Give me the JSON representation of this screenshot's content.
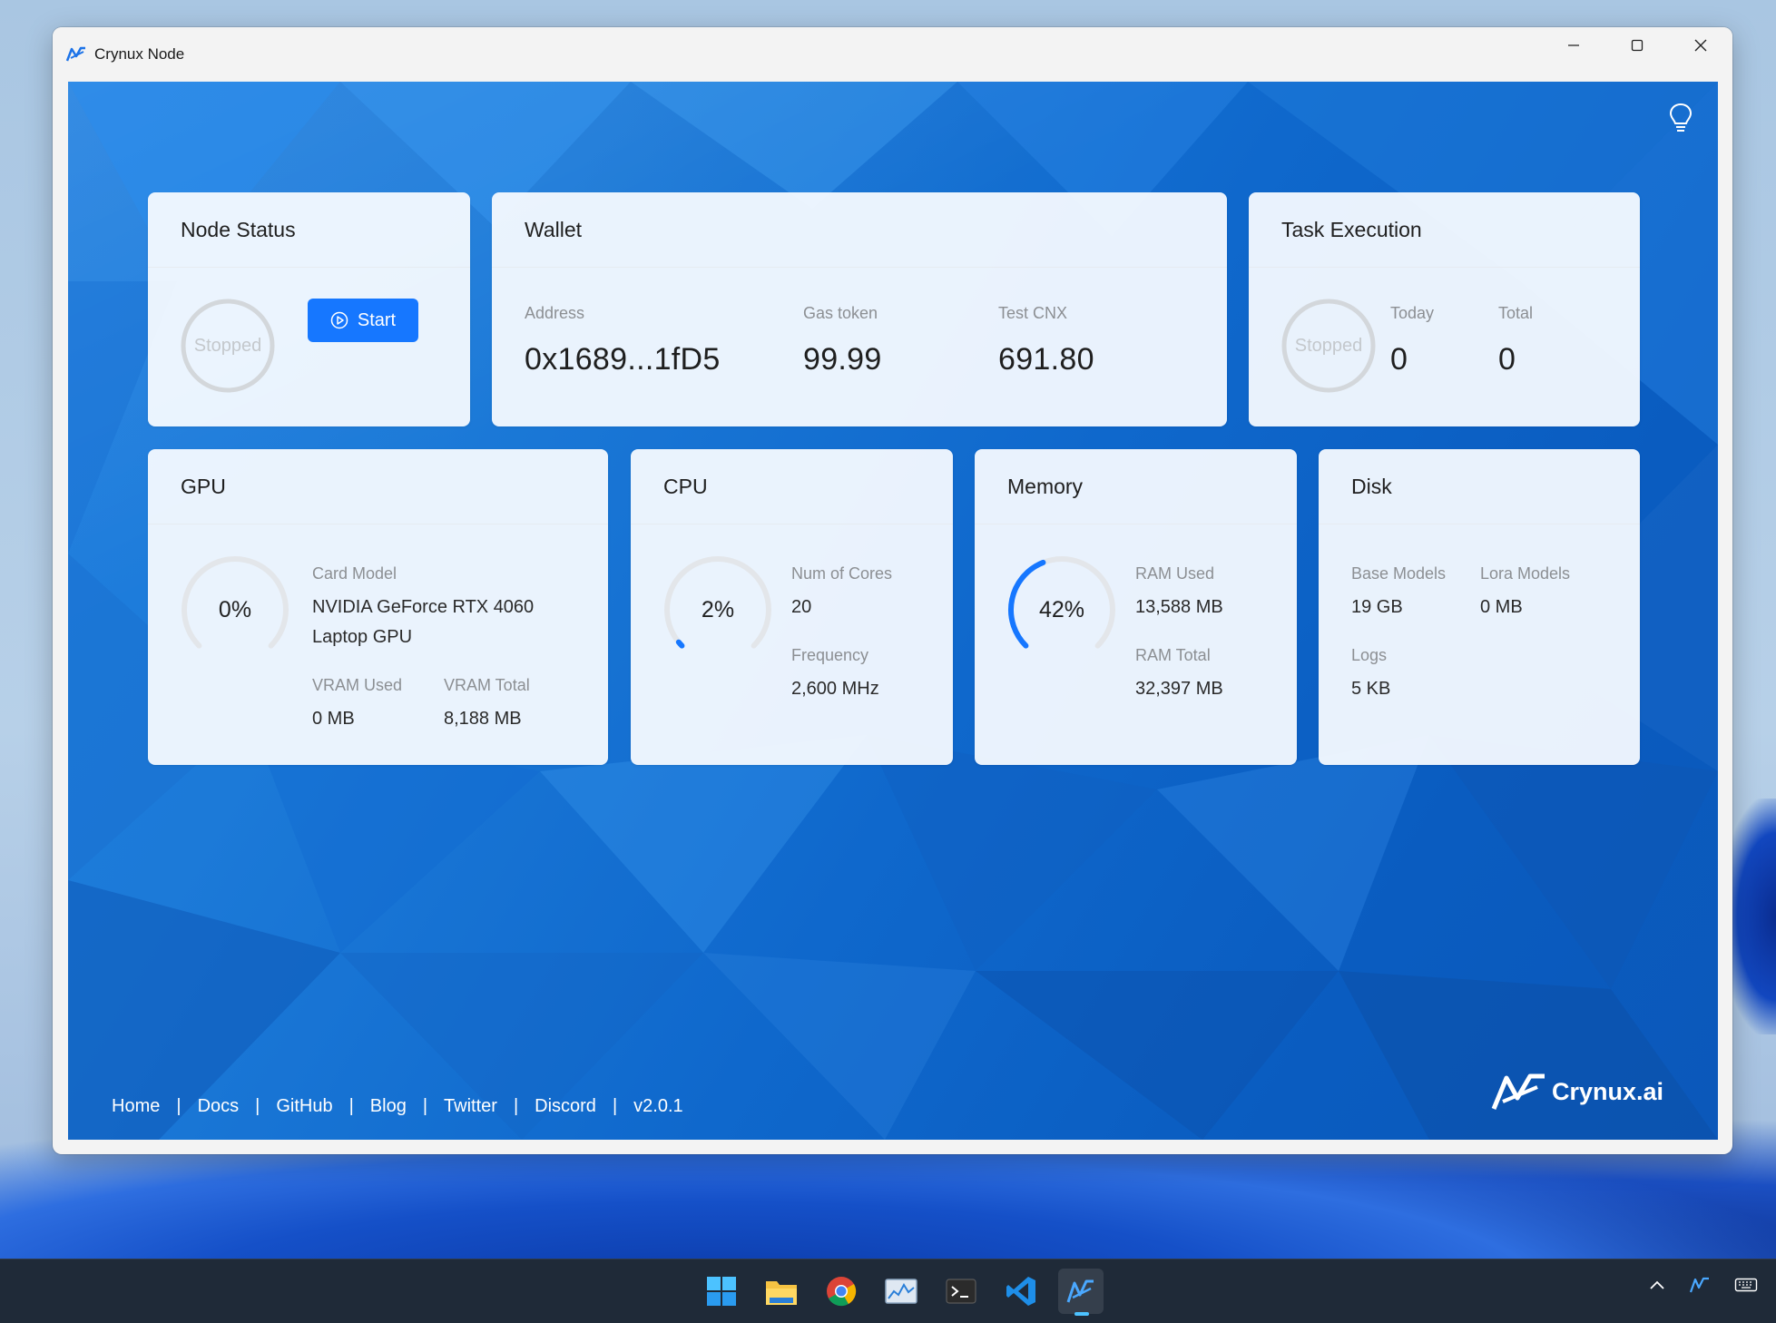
{
  "window": {
    "title": "Crynux Node"
  },
  "node_status": {
    "title": "Node Status",
    "state": "Stopped",
    "start_label": "Start"
  },
  "wallet": {
    "title": "Wallet",
    "address_label": "Address",
    "address": "0x1689...1fD5",
    "gas_label": "Gas token",
    "gas": "99.99",
    "cnx_label": "Test CNX",
    "cnx": "691.80"
  },
  "task": {
    "title": "Task Execution",
    "state": "Stopped",
    "today_label": "Today",
    "today": "0",
    "total_label": "Total",
    "total": "0"
  },
  "gpu": {
    "title": "GPU",
    "usage": "0%",
    "usage_fraction": 0,
    "card_model_label": "Card Model",
    "card_model_line1": "NVIDIA GeForce RTX 4060",
    "card_model_line2": "Laptop GPU",
    "vram_used_label": "VRAM Used",
    "vram_used": "0 MB",
    "vram_total_label": "VRAM Total",
    "vram_total": "8,188 MB"
  },
  "cpu": {
    "title": "CPU",
    "usage": "2%",
    "usage_fraction": 0.02,
    "cores_label": "Num of Cores",
    "cores": "20",
    "freq_label": "Frequency",
    "freq": "2,600 MHz"
  },
  "memory": {
    "title": "Memory",
    "usage": "42%",
    "usage_fraction": 0.42,
    "ram_used_label": "RAM Used",
    "ram_used": "13,588 MB",
    "ram_total_label": "RAM Total",
    "ram_total": "32,397 MB"
  },
  "disk": {
    "title": "Disk",
    "base_label": "Base Models",
    "base": "19 GB",
    "lora_label": "Lora Models",
    "lora": "0 MB",
    "logs_label": "Logs",
    "logs": "5 KB"
  },
  "footer": {
    "links": [
      "Home",
      "Docs",
      "GitHub",
      "Blog",
      "Twitter",
      "Discord"
    ],
    "version": "v2.0.1",
    "brand": "Crynux.ai"
  },
  "colors": {
    "accent": "#1677ff",
    "ring_track": "#e3e6ea",
    "ring_progress": "#1677ff"
  },
  "taskbar": {
    "apps": [
      "windows-start-icon",
      "file-explorer-icon",
      "chrome-icon",
      "resource-monitor-icon",
      "terminal-icon",
      "vscode-icon",
      "crynux-node-icon"
    ]
  }
}
